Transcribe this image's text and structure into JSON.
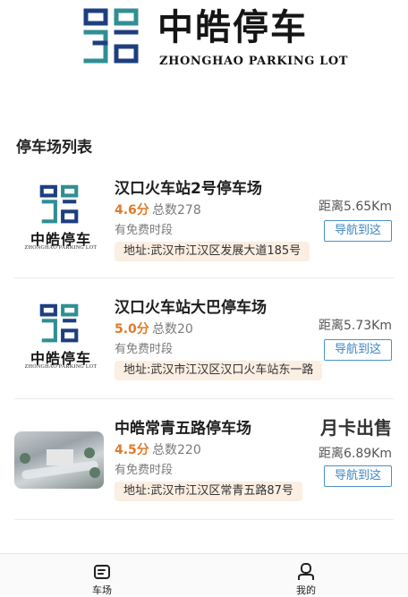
{
  "brand": {
    "name_cn": "中皓停车",
    "name_en": "ZHONGHAO PARKING LOT",
    "colors": {
      "navy": "#1d3f80",
      "teal": "#2f8f93"
    }
  },
  "section": {
    "title": "停车场列表"
  },
  "lots": [
    {
      "name": "汉口火车站2号停车场",
      "rating": "4.6分",
      "total": "总数278",
      "free": "有免费时段",
      "address": "地址:武汉市江汉区发展大道185号",
      "distance": "距离5.65Km",
      "nav_label": "导航到这",
      "thumb": {
        "type": "logo",
        "cn": "中皓停车",
        "en": "ZHONGHAO PARKING LOT"
      }
    },
    {
      "name": "汉口火车站大巴停车场",
      "rating": "5.0分",
      "total": "总数20",
      "free": "有免费时段",
      "address": "地址:武汉市江汉区汉口火车站东一路",
      "distance": "距离5.73Km",
      "nav_label": "导航到这",
      "thumb": {
        "type": "logo",
        "cn": "中皓停车",
        "en": "ZHONGHAO PARKING LOT"
      }
    },
    {
      "name": "中皓常青五路停车场",
      "rating": "4.5分",
      "total": "总数220",
      "free": "有免费时段",
      "address": "地址:武汉市江汉区常青五路87号",
      "distance": "距离6.89Km",
      "nav_label": "导航到这",
      "monthly_label": "月卡出售",
      "thumb": {
        "type": "photo"
      }
    }
  ],
  "tabbar": {
    "items": [
      {
        "label": "车场",
        "icon": "parking-lot-icon"
      },
      {
        "label": "我的",
        "icon": "user-icon"
      }
    ]
  },
  "colors": {
    "rating": "#e07b2a",
    "address_bg": "#fbeee2",
    "nav_border": "#4a92c9"
  }
}
